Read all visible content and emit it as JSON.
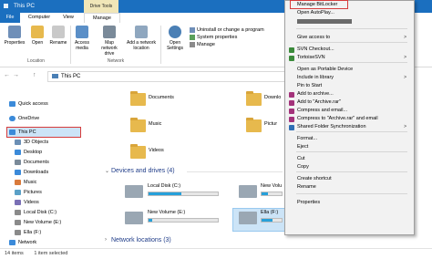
{
  "window": {
    "title": "This PC",
    "drive_tools_label": "Drive Tools"
  },
  "tabs": {
    "file": "File",
    "computer": "Computer",
    "view": "View",
    "manage": "Manage"
  },
  "ribbon": {
    "location_buttons": [
      "Properties",
      "Open",
      "Rename"
    ],
    "network_buttons": [
      "Access media",
      "Map network drive",
      "Add a network location"
    ],
    "open_settings": "Open Settings",
    "system_items": [
      "Uninstall or change a program",
      "System properties",
      "Manage"
    ],
    "groups": {
      "location": "Location",
      "network": "Network"
    }
  },
  "address": {
    "text": "This PC",
    "arrows": [
      "←",
      "→",
      "↑"
    ]
  },
  "nav": {
    "quick_access": "Quick access",
    "onedrive": "OneDrive",
    "this_pc": "This PC",
    "children": [
      "3D Objects",
      "Desktop",
      "Documents",
      "Downloads",
      "Music",
      "Pictures",
      "Videos",
      "Local Disk (C:)",
      "New Volume (E:)",
      "Ella (F:)",
      "Network"
    ]
  },
  "content": {
    "folders_left": [
      "Documents",
      "Music",
      "Videos"
    ],
    "folders_right": [
      "Downlo",
      "Pictur"
    ],
    "devices_header": "Devices and drives (4)",
    "drives": [
      {
        "name": "Local Disk (C:)",
        "free": "",
        "fill": 0.48
      },
      {
        "name": "New Volume (E:)",
        "free": "",
        "fill": 0.05
      },
      {
        "name": "New Volu",
        "free": "",
        "fill": 0.3
      },
      {
        "name": "Ella (F:)",
        "free": "",
        "fill": 0.55
      }
    ],
    "network_header": "Network locations (3)"
  },
  "status": {
    "items": "14 items",
    "selected": "1 item selected"
  },
  "context_menu": {
    "items": [
      {
        "label": "Manage BitLocker",
        "icon": "",
        "arrow": ""
      },
      {
        "label": "Open AutoPlay...",
        "icon": "",
        "arrow": ""
      },
      {
        "label": "",
        "icon": "",
        "arrow": ""
      },
      {
        "label": "Give access to",
        "icon": "",
        "arrow": ">"
      },
      {
        "label": "SVN Checkout...",
        "icon": "svn",
        "arrow": ""
      },
      {
        "label": "TortoiseSVN",
        "icon": "svn",
        "arrow": ">"
      },
      {
        "label": "Open as Portable Device",
        "icon": "",
        "arrow": ""
      },
      {
        "label": "Include in library",
        "icon": "",
        "arrow": ">"
      },
      {
        "label": "Pin to Start",
        "icon": "",
        "arrow": ""
      },
      {
        "label": "Add to archive...",
        "icon": "rar",
        "arrow": ""
      },
      {
        "label": "Add to \"Archive.rar\"",
        "icon": "rar",
        "arrow": ""
      },
      {
        "label": "Compress and email...",
        "icon": "rar",
        "arrow": ""
      },
      {
        "label": "Compress to \"Archive.rar\" and email",
        "icon": "rar",
        "arrow": ""
      },
      {
        "label": "Shared Folder Synchronization",
        "icon": "sync",
        "arrow": ">"
      },
      {
        "label": "Format...",
        "icon": "",
        "arrow": ""
      },
      {
        "label": "Eject",
        "icon": "",
        "arrow": ""
      },
      {
        "label": "Cut",
        "icon": "",
        "arrow": ""
      },
      {
        "label": "Copy",
        "icon": "",
        "arrow": ""
      },
      {
        "label": "Create shortcut",
        "icon": "",
        "arrow": ""
      },
      {
        "label": "Rename",
        "icon": "",
        "arrow": ""
      },
      {
        "label": "Properties",
        "icon": "",
        "arrow": ""
      }
    ]
  },
  "colors": {
    "accent": "#1b6fbf",
    "highlight": "#d63c3c",
    "selection": "#cce4f7",
    "folder": "#e7b94d",
    "bar_fill": "#26a0da"
  }
}
